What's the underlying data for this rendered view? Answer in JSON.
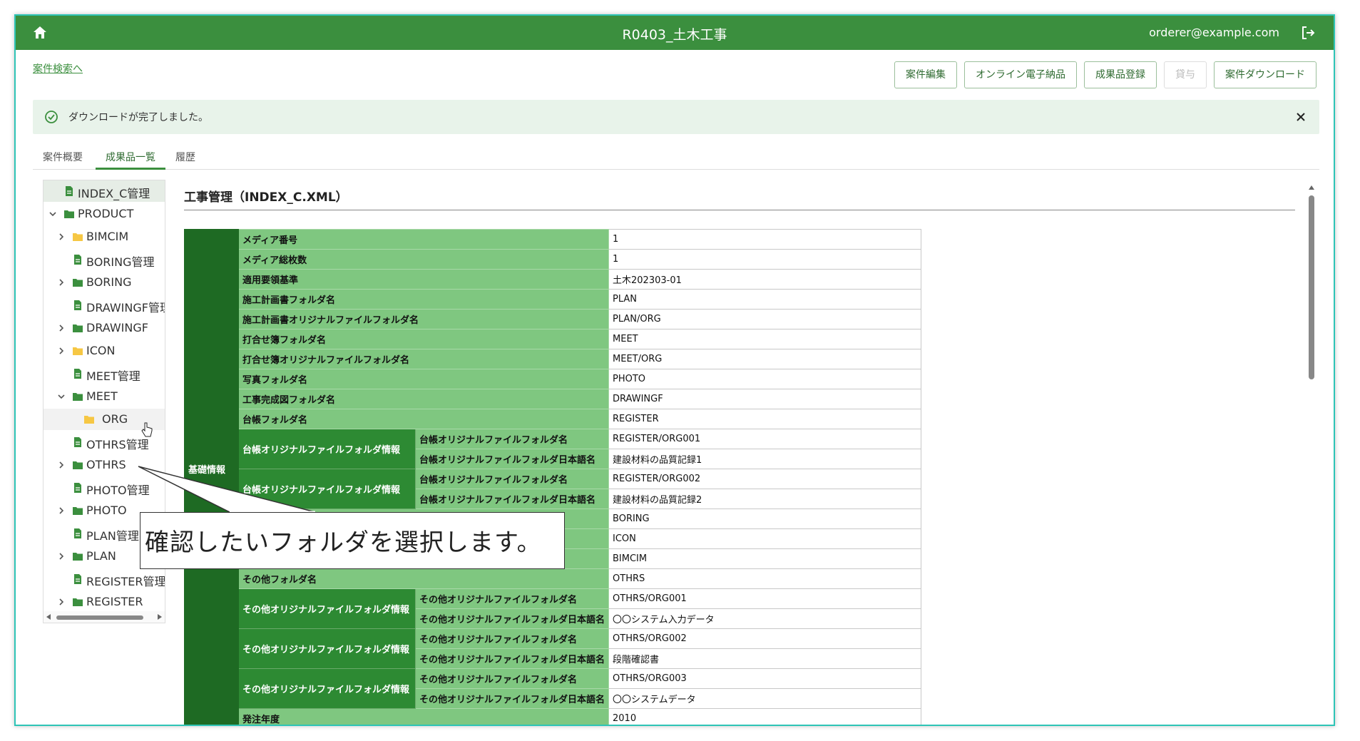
{
  "header": {
    "title": "R0403_土木工事",
    "user": "orderer@example.com"
  },
  "nav": {
    "back_link": "案件検索へ"
  },
  "actions": {
    "edit": "案件編集",
    "online_delivery": "オンライン電子納品",
    "register_deliverable": "成果品登録",
    "grant": "貸与",
    "download": "案件ダウンロード"
  },
  "alert": {
    "message": "ダウンロードが完了しました。"
  },
  "tabs": {
    "overview": "案件概要",
    "deliverables": "成果品一覧",
    "history": "履歴"
  },
  "tree": {
    "items": [
      {
        "label": "INDEX_C管理",
        "kind": "file"
      },
      {
        "label": "PRODUCT",
        "kind": "folder"
      },
      {
        "label": "BIMCIM",
        "kind": "folder-yellow"
      },
      {
        "label": "BORING管理",
        "kind": "file"
      },
      {
        "label": "BORING",
        "kind": "folder"
      },
      {
        "label": "DRAWINGF管理",
        "kind": "file"
      },
      {
        "label": "DRAWINGF",
        "kind": "folder"
      },
      {
        "label": "ICON",
        "kind": "folder-yellow"
      },
      {
        "label": "MEET管理",
        "kind": "file"
      },
      {
        "label": "MEET",
        "kind": "folder"
      },
      {
        "label": "ORG",
        "kind": "folder-yellow"
      },
      {
        "label": "OTHRS管理",
        "kind": "file"
      },
      {
        "label": "OTHRS",
        "kind": "folder"
      },
      {
        "label": "PHOTO管理",
        "kind": "file"
      },
      {
        "label": "PHOTO",
        "kind": "folder"
      },
      {
        "label": "PLAN管理",
        "kind": "file"
      },
      {
        "label": "PLAN",
        "kind": "folder"
      },
      {
        "label": "REGISTER管理",
        "kind": "file"
      },
      {
        "label": "REGISTER",
        "kind": "folder"
      }
    ]
  },
  "content": {
    "title": "工事管理（INDEX_C.XML）",
    "group_label": "基礎情報",
    "rows": {
      "media_no": {
        "key": "メディア番号",
        "val": "1"
      },
      "media_total": {
        "key": "メディア総枚数",
        "val": "1"
      },
      "standard": {
        "key": "適用要領基準",
        "val": "土木202303-01"
      },
      "plan_folder": {
        "key": "施工計画書フォルダ名",
        "val": "PLAN"
      },
      "plan_org_folder": {
        "key": "施工計画書オリジナルファイルフォルダ名",
        "val": "PLAN/ORG"
      },
      "meet_folder": {
        "key": "打合せ簿フォルダ名",
        "val": "MEET"
      },
      "meet_org_folder": {
        "key": "打合せ簿オリジナルファイルフォルダ名",
        "val": "MEET/ORG"
      },
      "photo_folder": {
        "key": "写真フォルダ名",
        "val": "PHOTO"
      },
      "drawingf_folder": {
        "key": "工事完成図フォルダ名",
        "val": "DRAWINGF"
      },
      "register_folder": {
        "key": "台帳フォルダ名",
        "val": "REGISTER"
      },
      "register_org_info_1": {
        "sub": "台帳オリジナルファイルフォルダ情報",
        "k1": "台帳オリジナルファイルフォルダ名",
        "v1": "REGISTER/ORG001",
        "k2": "台帳オリジナルファイルフォルダ日本語名",
        "v2": "建設材料の品質記録1"
      },
      "register_org_info_2": {
        "sub": "台帳オリジナルファイルフォルダ情報",
        "k1": "台帳オリジナルファイルフォルダ名",
        "v1": "REGISTER/ORG002",
        "k2": "台帳オリジナルファイルフォルダ日本語名",
        "v2": "建設材料の品質記録2"
      },
      "boring_folder": {
        "val": "BORING"
      },
      "icon_folder": {
        "val": "ICON"
      },
      "bimcim_folder": {
        "val": "BIMCIM"
      },
      "othrs_folder": {
        "key": "その他フォルダ名",
        "val": "OTHRS"
      },
      "othrs_org_info_1": {
        "sub": "その他オリジナルファイルフォルダ情報",
        "k1": "その他オリジナルファイルフォルダ名",
        "v1": "OTHRS/ORG001",
        "k2": "その他オリジナルファイルフォルダ日本語名",
        "v2": "〇〇システム入力データ"
      },
      "othrs_org_info_2": {
        "sub": "その他オリジナルファイルフォルダ情報",
        "k1": "その他オリジナルファイルフォルダ名",
        "v1": "OTHRS/ORG002",
        "k2": "その他オリジナルファイルフォルダ日本語名",
        "v2": "段階確認書"
      },
      "othrs_org_info_3": {
        "sub": "その他オリジナルファイルフォルダ情報",
        "k1": "その他オリジナルファイルフォルダ名",
        "v1": "OTHRS/ORG003",
        "k2": "その他オリジナルファイルフォルダ日本語名",
        "v2": "〇〇システムデータ"
      },
      "order_year": {
        "key": "発注年度",
        "val": "2010"
      }
    }
  },
  "callout": {
    "text": "確認したいフォルダを選択します。"
  },
  "colors": {
    "header": "#3b8f3e",
    "frame": "#2ec4b6",
    "group": "#1e6a23",
    "sub": "#2d8a33",
    "key": "#7fc780"
  }
}
